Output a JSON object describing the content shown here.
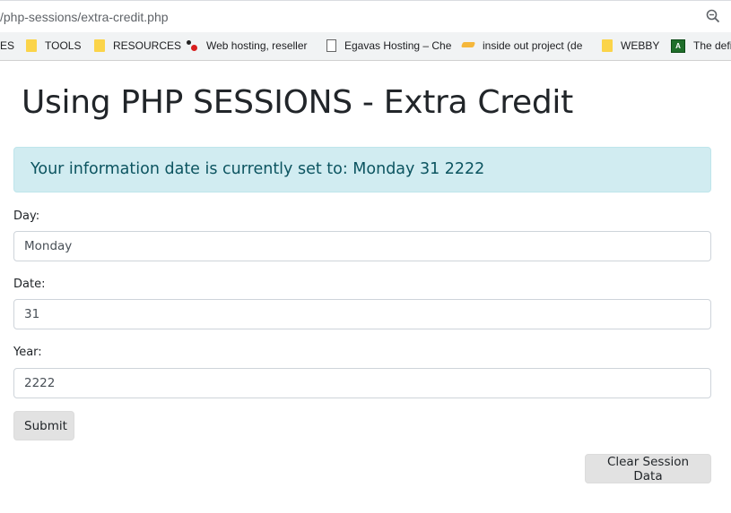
{
  "browser": {
    "url": "/php-sessions/extra-credit.php",
    "zoom_icon": "zoom-icon",
    "bookmarks": [
      {
        "label": "ES",
        "icon": "none"
      },
      {
        "label": "TOOLS",
        "icon": "folder-icon"
      },
      {
        "label": "RESOURCES",
        "icon": "folder-icon"
      },
      {
        "label": "Web hosting, reseller",
        "icon": "web-hosting-icon"
      },
      {
        "label": "Egavas Hosting – Che",
        "icon": "page-icon"
      },
      {
        "label": "inside out project (de",
        "icon": "grad-cap-icon"
      },
      {
        "label": "WEBBY",
        "icon": "folder-icon"
      },
      {
        "label": "The defi",
        "icon": "green-square-icon"
      }
    ]
  },
  "page": {
    "title": "Using PHP SESSIONS - Extra Credit",
    "alert_text": "Your information date is currently set to: Monday 31 2222",
    "colors": {
      "alert_bg": "#d1ecf1",
      "alert_text": "#0c5460",
      "button_bg": "#e2e2e2"
    }
  },
  "form": {
    "day_label": "Day:",
    "day_value": "Monday",
    "date_label": "Date:",
    "date_value": "31",
    "year_label": "Year:",
    "year_value": "2222",
    "submit_label": "Submit",
    "clear_label": "Clear Session Data"
  }
}
